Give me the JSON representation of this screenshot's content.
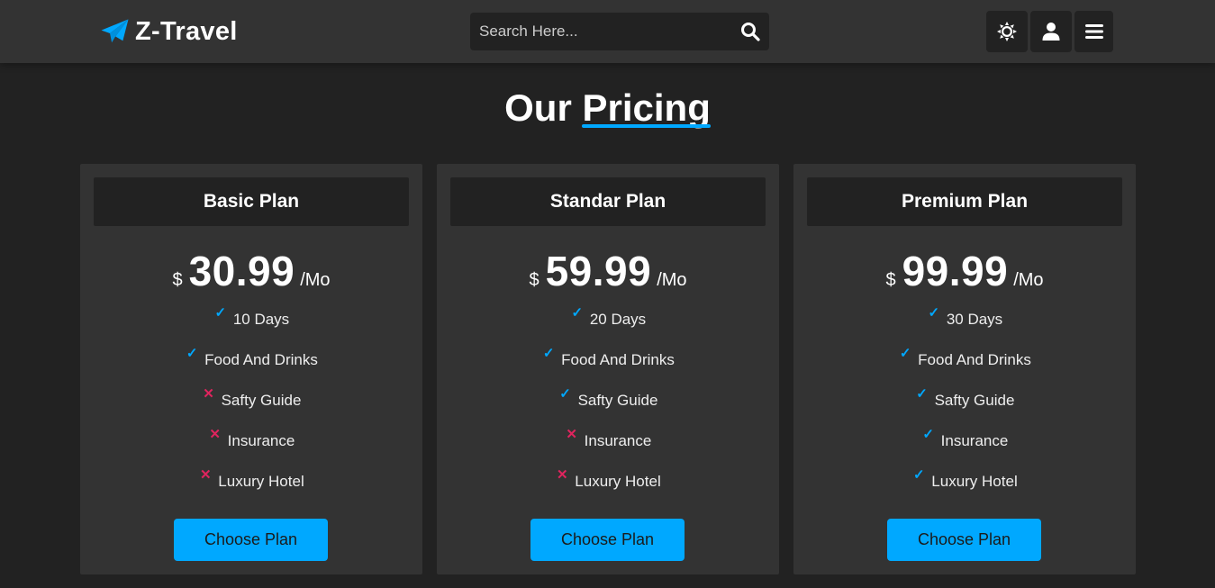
{
  "header": {
    "brand": "Z-Travel",
    "search_placeholder": "Search Here...",
    "icons": [
      "paper-plane-icon",
      "search-icon",
      "sun-icon",
      "user-icon",
      "menu-icon"
    ],
    "accent_color": "#00a8ff"
  },
  "section": {
    "title_first": "Our",
    "title_accent": "Pricing"
  },
  "plans": [
    {
      "name": "Basic Plan",
      "currency": "$",
      "price": "30.99",
      "period": "/Mo",
      "features": [
        {
          "label": "10 Days",
          "included": true,
          "mark": "✓"
        },
        {
          "label": "Food And Drinks",
          "included": true,
          "mark": "✓"
        },
        {
          "label": "Safty Guide",
          "included": false,
          "mark": "✕"
        },
        {
          "label": "Insurance",
          "included": false,
          "mark": "✕"
        },
        {
          "label": "Luxury Hotel",
          "included": false,
          "mark": "✕"
        }
      ],
      "button": "Choose Plan"
    },
    {
      "name": "Standar Plan",
      "currency": "$",
      "price": "59.99",
      "period": "/Mo",
      "features": [
        {
          "label": "20 Days",
          "included": true,
          "mark": "✓"
        },
        {
          "label": "Food And Drinks",
          "included": true,
          "mark": "✓"
        },
        {
          "label": "Safty Guide",
          "included": true,
          "mark": "✓"
        },
        {
          "label": "Insurance",
          "included": false,
          "mark": "✕"
        },
        {
          "label": "Luxury Hotel",
          "included": false,
          "mark": "✕"
        }
      ],
      "button": "Choose Plan"
    },
    {
      "name": "Premium Plan",
      "currency": "$",
      "price": "99.99",
      "period": "/Mo",
      "features": [
        {
          "label": "30 Days",
          "included": true,
          "mark": "✓"
        },
        {
          "label": "Food And Drinks",
          "included": true,
          "mark": "✓"
        },
        {
          "label": "Safty Guide",
          "included": true,
          "mark": "✓"
        },
        {
          "label": "Insurance",
          "included": true,
          "mark": "✓"
        },
        {
          "label": "Luxury Hotel",
          "included": true,
          "mark": "✓"
        }
      ],
      "button": "Choose Plan"
    }
  ]
}
